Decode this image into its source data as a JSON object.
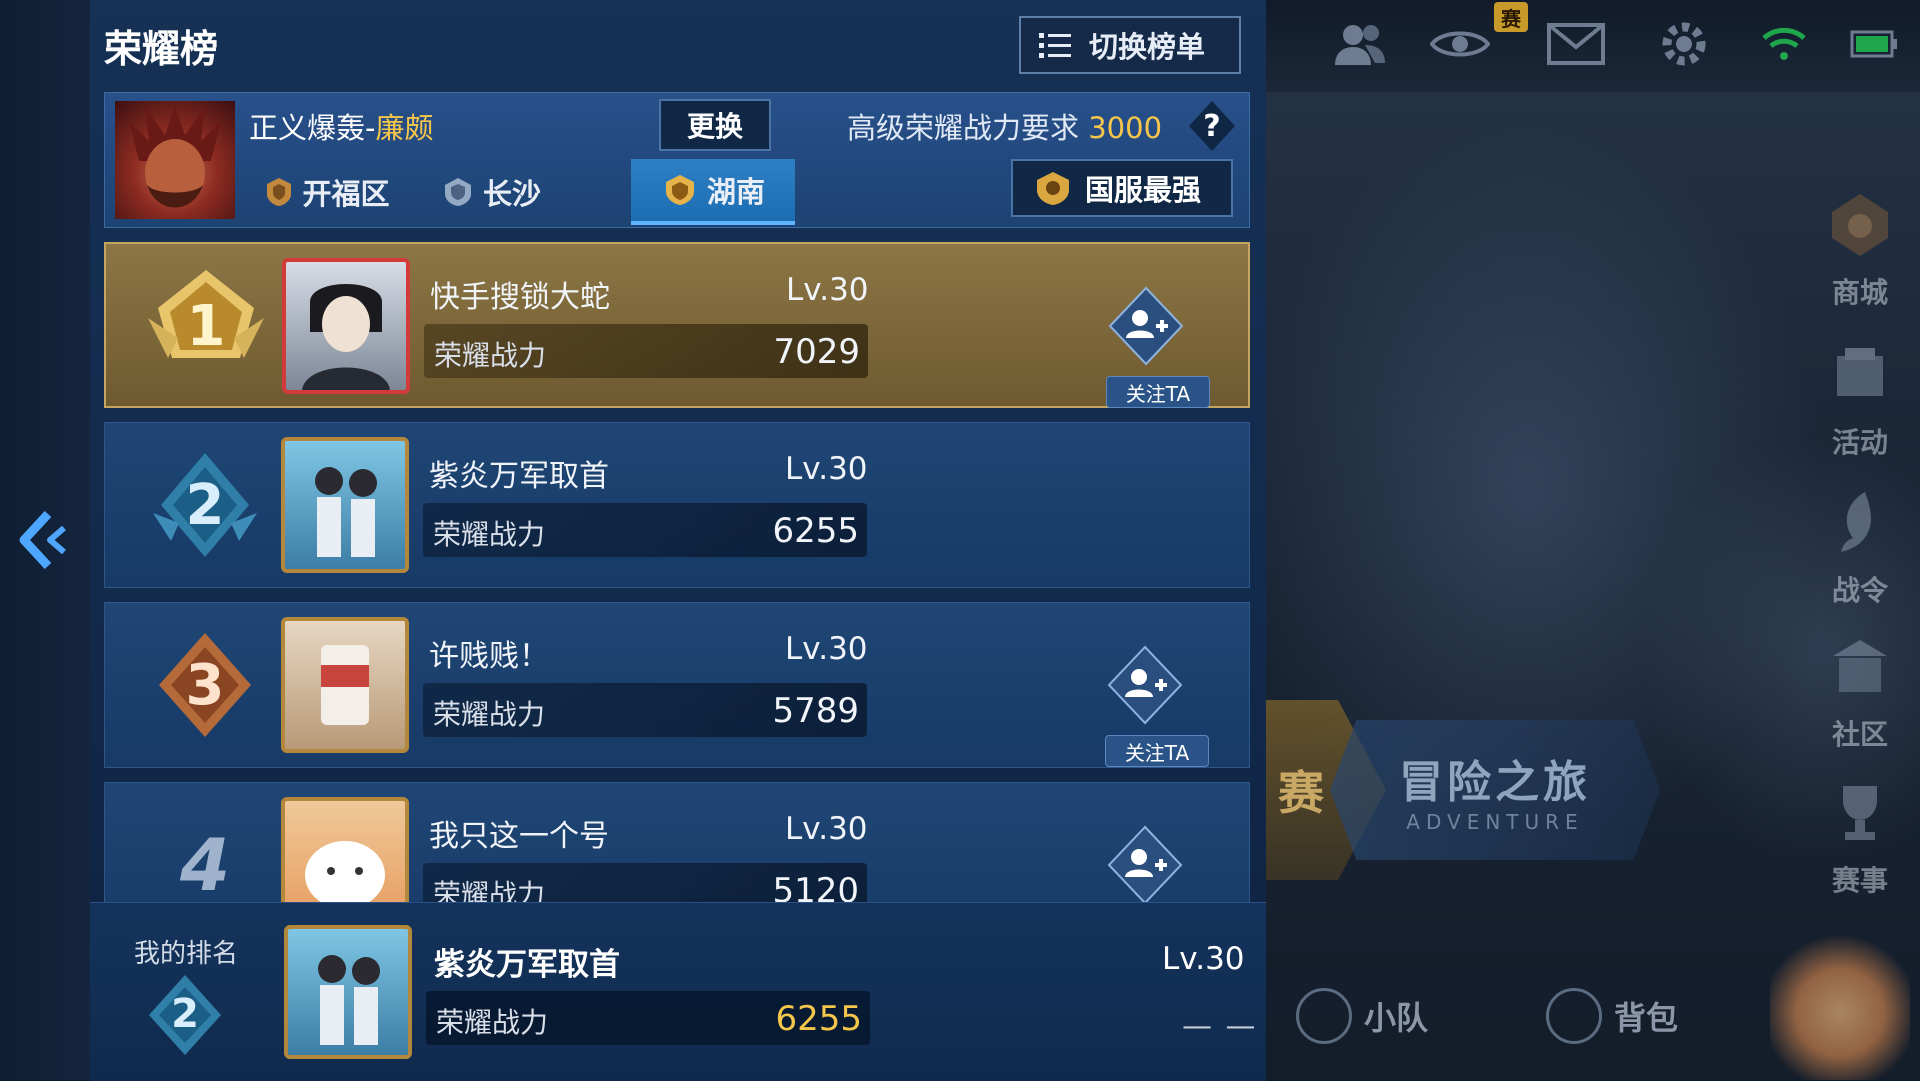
{
  "panel": {
    "title": "荣耀榜",
    "switch_button": "切换榜单"
  },
  "header": {
    "hero_name_prefix": "正义爆轰-",
    "hero_name_highlight": "廉颇",
    "change_button": "更换",
    "requirement_label": "高级荣耀战力要求",
    "requirement_value": "3000",
    "help_button": "?",
    "region_tabs": [
      {
        "label": "开福区",
        "active": false
      },
      {
        "label": "长沙",
        "active": false
      },
      {
        "label": "湖南",
        "active": true
      }
    ],
    "strongest_button": "国服最强"
  },
  "rankings": [
    {
      "rank": "1",
      "name": "快手搜锁大蛇",
      "level": "Lv.30",
      "power_label": "荣耀战力",
      "power": "7029",
      "follow_label": "关注TA"
    },
    {
      "rank": "2",
      "name": "紫炎万军取首",
      "level": "Lv.30",
      "power_label": "荣耀战力",
      "power": "6255"
    },
    {
      "rank": "3",
      "name": "许贱贱！",
      "level": "Lv.30",
      "power_label": "荣耀战力",
      "power": "5789",
      "follow_label": "关注TA"
    },
    {
      "rank": "4",
      "name": "我只这一个号",
      "level": "Lv.30",
      "power_label": "荣耀战力",
      "power": "5120"
    }
  ],
  "my_rank": {
    "title": "我的排名",
    "rank": "2",
    "name": "紫炎万军取首",
    "level": "Lv.30",
    "power_label": "荣耀战力",
    "power": "6255",
    "dash": "— —"
  },
  "background": {
    "top_badge": "赛",
    "side_menu": [
      "商城",
      "活动",
      "战令",
      "社区",
      "赛事"
    ],
    "mode_banner": "冒险之旅",
    "mode_banner_sub": "ADVENTURE",
    "mode_left": "赛",
    "bottom_menu": [
      "小队",
      "背包"
    ]
  },
  "colors": {
    "accent_gold": "#f5c64b",
    "panel_blue": "#163155",
    "active_tab": "#2e7fc4"
  },
  "icons": [
    "list-icon",
    "back-arrow-icon",
    "region-emblem-icon",
    "add-friend-icon",
    "question-icon",
    "friends-icon",
    "eye-icon",
    "mail-icon",
    "settings-icon",
    "wifi-icon",
    "battery-icon"
  ]
}
